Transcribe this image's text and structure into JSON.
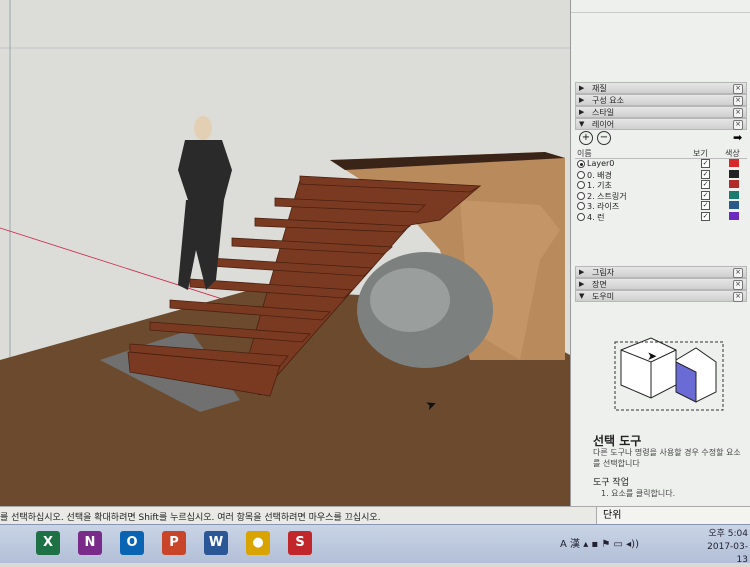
{
  "tray": {
    "header_label": "",
    "panels_top": [
      {
        "label": "재질"
      },
      {
        "label": "구성 요소"
      },
      {
        "label": "스타일"
      },
      {
        "label": "레이어"
      }
    ],
    "panels_bottom": [
      {
        "label": "그림자"
      },
      {
        "label": "장면"
      },
      {
        "label": "도우미"
      }
    ]
  },
  "layers": {
    "col_name": "이름",
    "col_visible": "보기",
    "col_color": "색상",
    "rows": [
      {
        "name": "Layer0",
        "active": true,
        "visible": "✓",
        "color": "#d62a2a"
      },
      {
        "name": "0. 배경",
        "active": false,
        "visible": "✓",
        "color": "#222222"
      },
      {
        "name": "1. 기초",
        "active": false,
        "visible": "✓",
        "color": "#b42a2a"
      },
      {
        "name": "2. 스트링거",
        "active": false,
        "visible": "✓",
        "color": "#1c7a6e"
      },
      {
        "name": "3. 라이즈",
        "active": false,
        "visible": "✓",
        "color": "#2a5a8a"
      },
      {
        "name": "4. 런",
        "active": false,
        "visible": "✓",
        "color": "#6a2ac0"
      }
    ]
  },
  "instructor": {
    "title": "선택 도구",
    "desc": "다른 도구나 명령을 사용할 경우 수정할 요소를 선택합니다",
    "ops_title": "도구 작업",
    "step1": "1. 요소를 클릭합니다."
  },
  "status": {
    "text": "를 선택하십시오. 선택을 확대하려면 Shift를 누르십시오. 여러 항목을 선택하려면 마우스를 끄십시오.",
    "measure_label": "단위"
  },
  "taskbar": {
    "apps": [
      {
        "icon": "excel-icon",
        "letter": "X",
        "color": "#1e7145"
      },
      {
        "icon": "onenote-icon",
        "letter": "N",
        "color": "#7a2b8a"
      },
      {
        "icon": "outlook-icon",
        "letter": "O",
        "color": "#0a64b4"
      },
      {
        "icon": "powerpoint-icon",
        "letter": "P",
        "color": "#c9452a"
      },
      {
        "icon": "word-icon",
        "letter": "W",
        "color": "#2b5797"
      },
      {
        "icon": "chrome-icon",
        "letter": "●",
        "color": "#d9a400"
      },
      {
        "icon": "sketchup-icon",
        "letter": "S",
        "color": "#c0262a"
      }
    ],
    "ime": "A 漢",
    "time": "오후 5:04",
    "date": "2017-03-13"
  }
}
